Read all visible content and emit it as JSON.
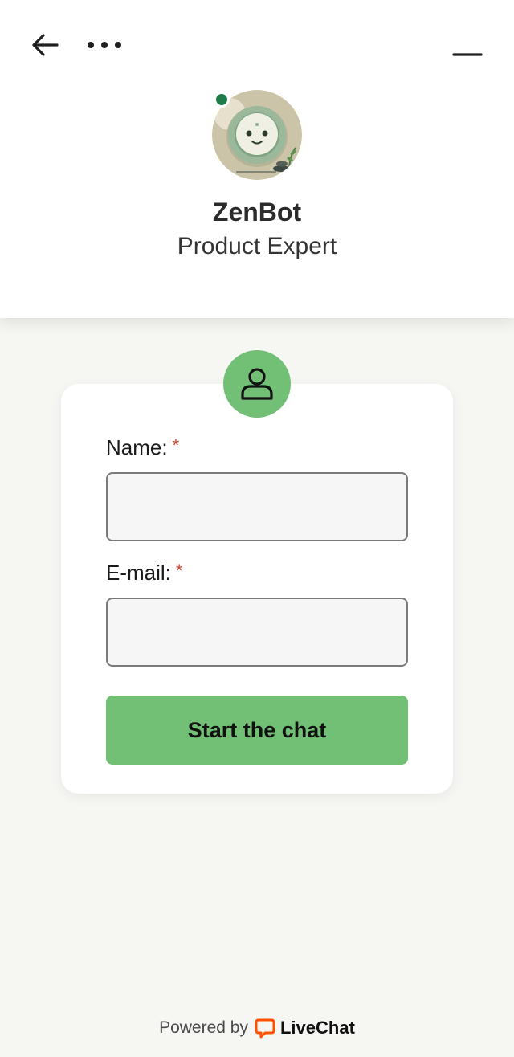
{
  "header": {
    "back_icon": "arrow-left-icon",
    "more_icon": "more-horizontal-icon",
    "minimize_icon": "minimize-icon",
    "agent": {
      "name": "ZenBot",
      "role": "Product Expert",
      "status": "online",
      "status_color": "#1e7b4a"
    }
  },
  "form": {
    "badge_icon": "user-icon",
    "accent_color": "#72c075",
    "fields": [
      {
        "label": "Name:",
        "required_mark": "*",
        "value": "",
        "placeholder": ""
      },
      {
        "label": "E-mail:",
        "required_mark": "*",
        "value": "",
        "placeholder": ""
      }
    ],
    "submit_label": "Start the chat"
  },
  "footer": {
    "powered_by": "Powered by",
    "brand_name": "LiveChat",
    "brand_icon": "livechat-logo-icon",
    "brand_color": "#ff5100"
  }
}
